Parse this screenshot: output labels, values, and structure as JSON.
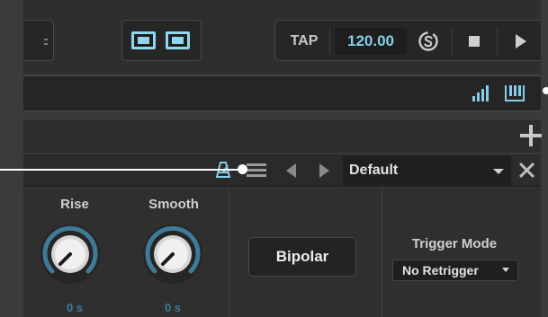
{
  "transport": {
    "tap_label": "TAP",
    "bpm_value": "120.00",
    "sync_icon": "sync-icon",
    "stop_icon": "stop-icon",
    "play_icon": "play-icon"
  },
  "view_buttons": [
    "view-layout-a-icon",
    "view-layout-b-icon"
  ],
  "strip": {
    "icons": [
      "meter-icon",
      "keys-icon"
    ]
  },
  "preset_bar": {
    "preset_name": "Default",
    "icons": [
      "metronome-icon",
      "menu-icon",
      "prev-icon",
      "next-icon",
      "close-icon",
      "plus-icon"
    ]
  },
  "controls": {
    "rise": {
      "label": "Rise",
      "value": "0 s"
    },
    "smooth": {
      "label": "Smooth",
      "value": "0 s"
    },
    "bipolar_label": "Bipolar",
    "trigger_mode": {
      "label": "Trigger Mode",
      "value": "No Retrigger"
    }
  },
  "colors": {
    "accent": "#86cde8",
    "knob_ring": "#3f7b99",
    "background": "#2f2f2f"
  }
}
